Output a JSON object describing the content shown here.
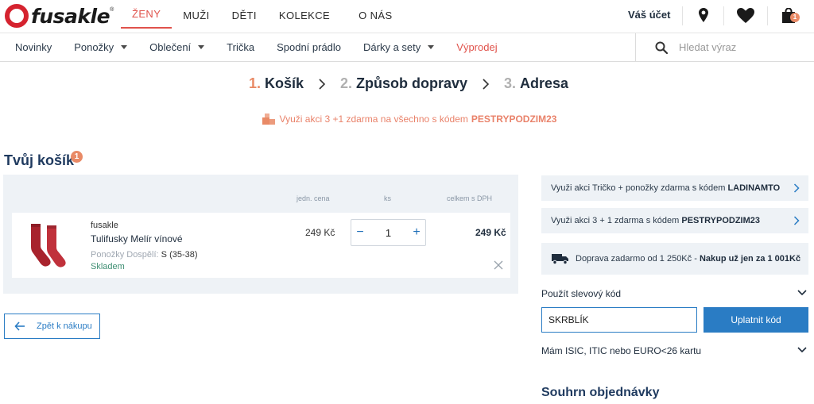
{
  "brand": {
    "logo_text": "fusakle",
    "logo_mark": "®"
  },
  "main_nav": [
    {
      "label": "ŽENY",
      "active": true
    },
    {
      "label": "MUŽI",
      "active": false
    },
    {
      "label": "DĚTI",
      "active": false
    },
    {
      "label": "KOLEKCE",
      "active": false
    },
    {
      "label": "O NÁS",
      "active": false
    }
  ],
  "header": {
    "account_label": "Váš účet",
    "cart_badge": "1",
    "icons": [
      "map-pin-icon",
      "heart-icon",
      "shopping-bag-icon"
    ]
  },
  "categories": [
    {
      "label": "Novinky",
      "dropdown": false
    },
    {
      "label": "Ponožky",
      "dropdown": true
    },
    {
      "label": "Oblečení",
      "dropdown": true
    },
    {
      "label": "Trička",
      "dropdown": false
    },
    {
      "label": "Spodní prádlo",
      "dropdown": false
    },
    {
      "label": "Dárky a sety",
      "dropdown": true
    },
    {
      "label": "Výprodej",
      "dropdown": false
    }
  ],
  "search": {
    "placeholder": "Hledat výraz"
  },
  "steps": [
    {
      "num": "1.",
      "label": "Košík",
      "active": true
    },
    {
      "num": "2.",
      "label": "Způsob dopravy",
      "active": false
    },
    {
      "num": "3.",
      "label": "Adresa",
      "active": false
    }
  ],
  "promo_banner": {
    "text": "Využi akci 3 +1 zdarma na všechno s kódem",
    "code": "PESTRYPODZIM23"
  },
  "cart": {
    "title": "Tvůj košík",
    "count": "1",
    "columns": {
      "unit_price": "jedn. cena",
      "qty": "ks",
      "total": "celkem s DPH"
    },
    "items": [
      {
        "brand": "fusakle",
        "name": "Tulifusky Melír vínové",
        "variant_label": "Ponožky Dospělí:",
        "variant_value": "S (35-38)",
        "stock": "Skladem",
        "unit_price": "249 Kč",
        "qty": "1",
        "qty_minus": "−",
        "qty_plus": "+",
        "total": "249 Kč"
      }
    ],
    "back_label": "Zpět k nákupu"
  },
  "sidebar": {
    "promos": [
      {
        "text": "Využi akci Tričko + ponožky zdarma s kódem",
        "code": "LADINAMTO"
      },
      {
        "text": "Využi akci 3 + 1 zdarma s kódem",
        "code": "PESTRYPODZIM23"
      }
    ],
    "shipping": {
      "text": "Doprava zadarmo od 1 250Kč -",
      "highlight": "Nakup už jen za 1 001Kč"
    },
    "discount": {
      "label": "Použít slevový kód",
      "value": "SKRBLÍK",
      "apply_label": "Uplatnit kód"
    },
    "isic_label": "Mám ISIC, ITIC nebo EURO<26 kartu",
    "summary_title": "Souhrn objednávky"
  },
  "colors": {
    "accent": "#e0524b",
    "promo": "#e98a66",
    "primary": "#2a7cc4",
    "panel": "#eef2f6",
    "sock": "#a8232d"
  }
}
